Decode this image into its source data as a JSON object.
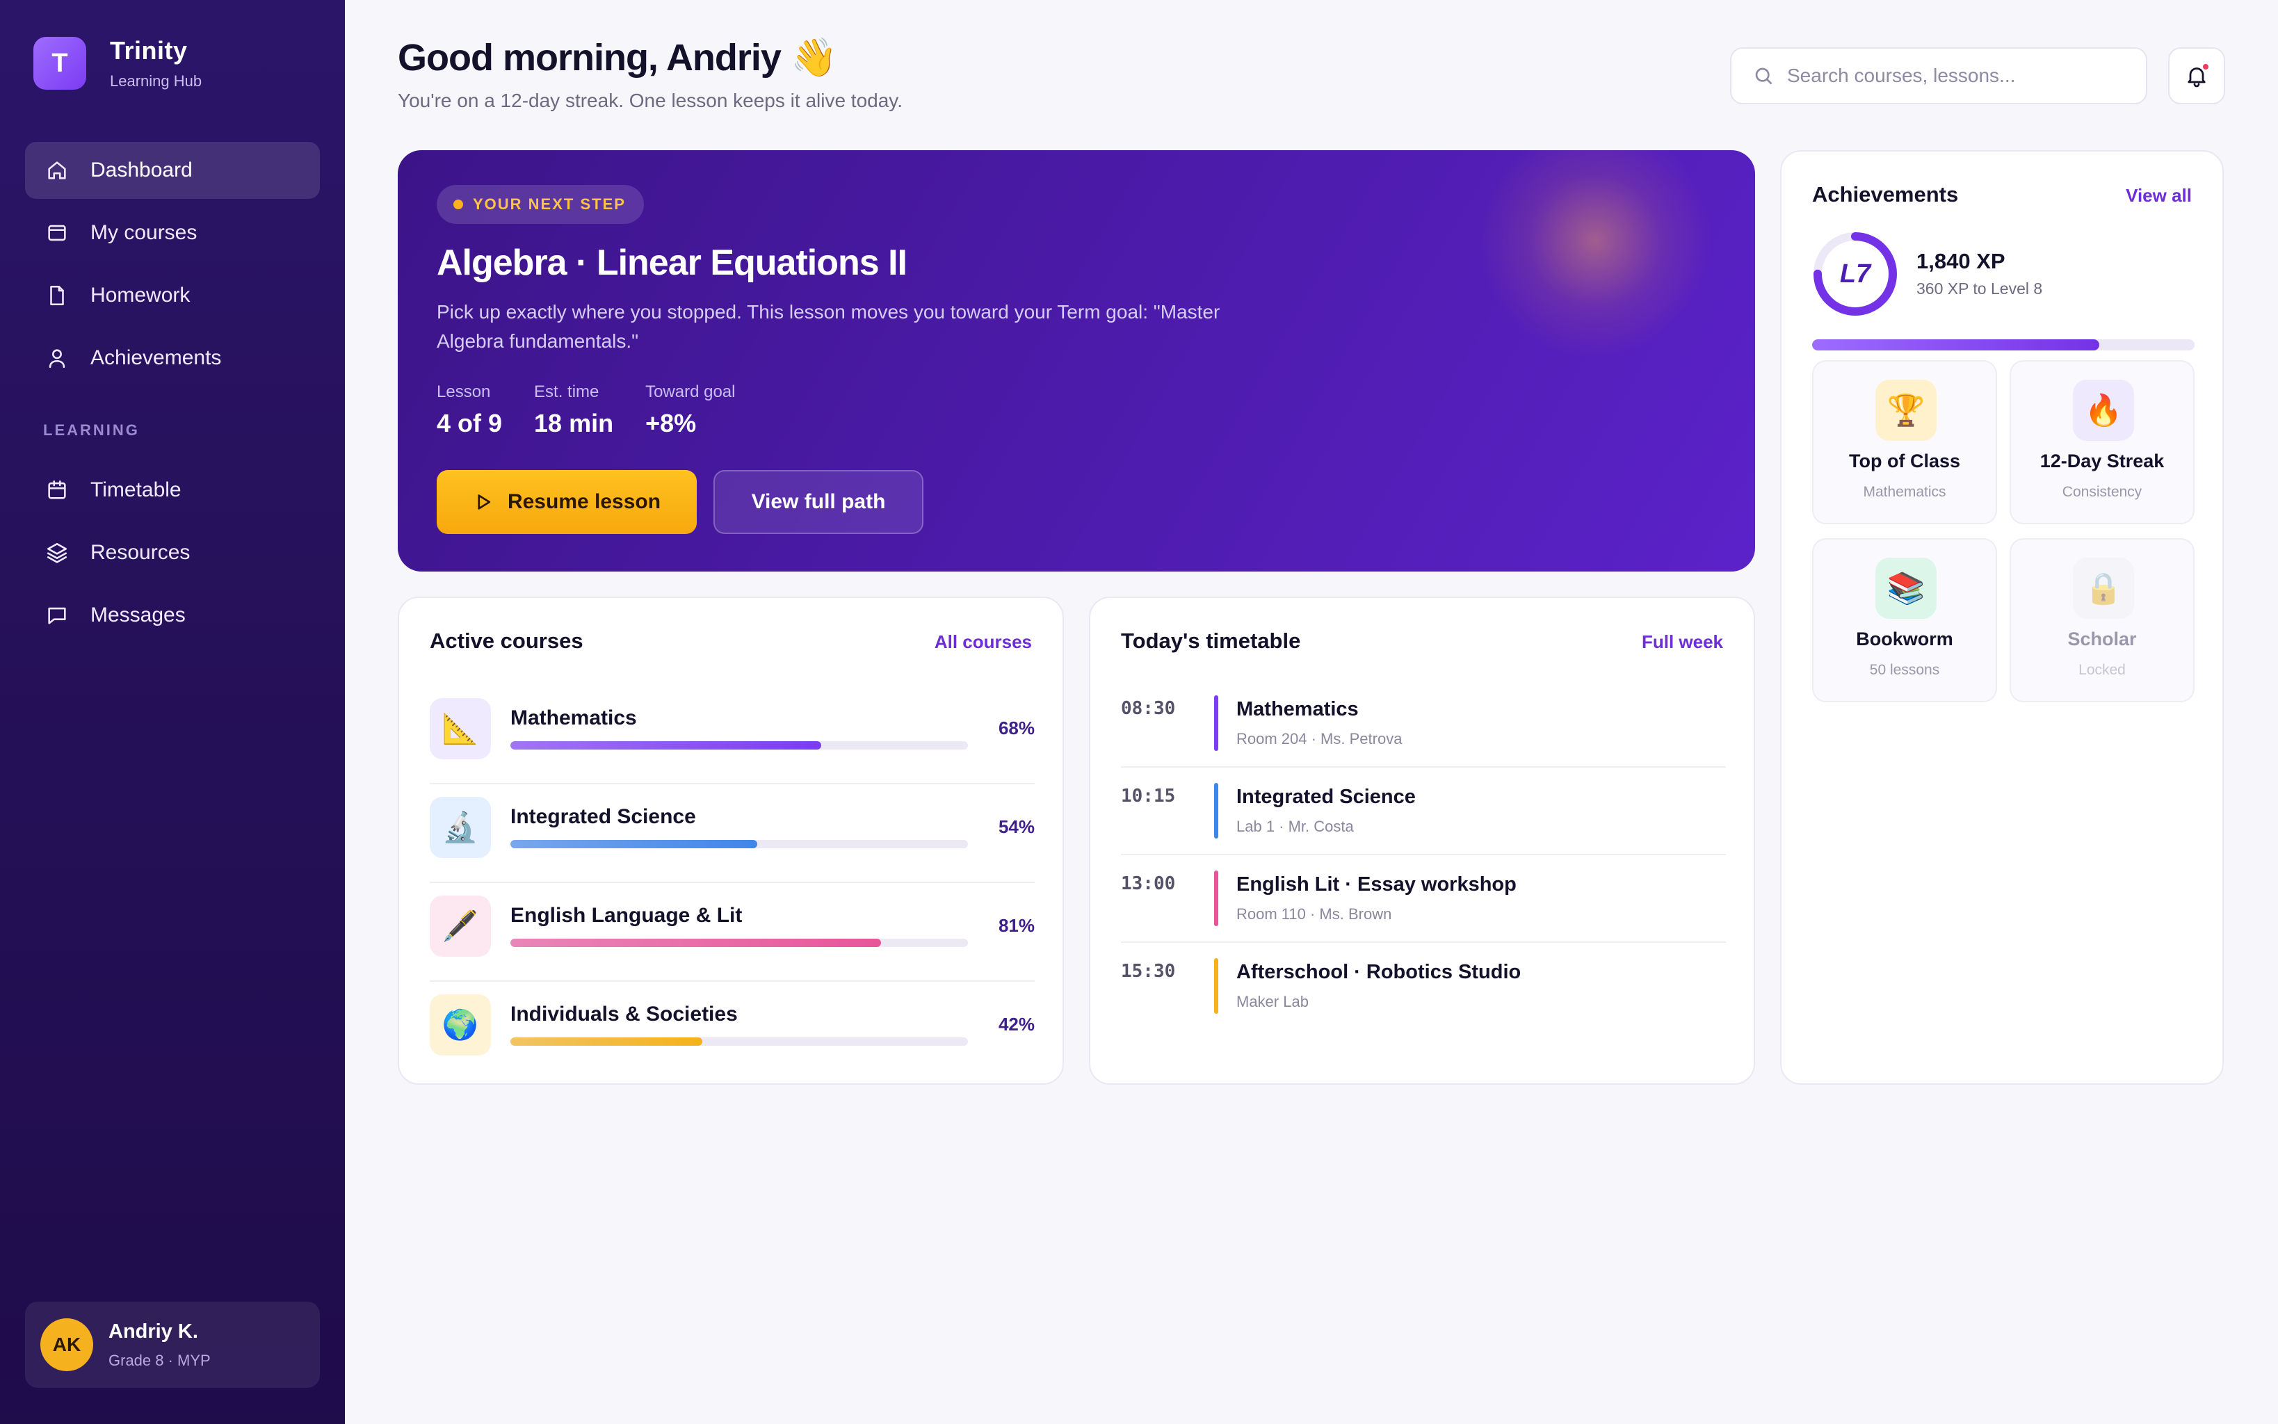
{
  "brand": {
    "logo_letter": "T",
    "name": "Trinity",
    "subtitle": "Learning Hub"
  },
  "nav": {
    "main": [
      {
        "label": "Dashboard",
        "icon": "home-icon",
        "active": true
      },
      {
        "label": "My courses",
        "icon": "courses-icon"
      },
      {
        "label": "Homework",
        "icon": "document-icon"
      },
      {
        "label": "Achievements",
        "icon": "user-icon"
      }
    ],
    "section_label": "LEARNING",
    "learning": [
      {
        "label": "Timetable",
        "icon": "calendar-icon"
      },
      {
        "label": "Resources",
        "icon": "layers-icon"
      },
      {
        "label": "Messages",
        "icon": "chat-icon"
      }
    ]
  },
  "user": {
    "initials": "AK",
    "name": "Andriy K.",
    "meta": "Grade 8 · MYP"
  },
  "header": {
    "greeting": "Good morning, Andriy 👋",
    "subtitle": "You're on a 12-day streak. One lesson keeps it alive today.",
    "search_placeholder": "Search courses, lessons...",
    "notifications_unread": true
  },
  "hero": {
    "pill": "YOUR NEXT STEP",
    "title": "Algebra · Linear Equations II",
    "description": "Pick up exactly where you stopped. This lesson moves you toward your Term goal: \"Master Algebra fundamentals.\"",
    "stats": [
      {
        "label": "Lesson",
        "value": "4 of 9"
      },
      {
        "label": "Est. time",
        "value": "18 min"
      },
      {
        "label": "Toward goal",
        "value": "+8%"
      }
    ],
    "primary_button": "Resume lesson",
    "secondary_button": "View full path"
  },
  "courses": {
    "title": "Active courses",
    "link": "All courses",
    "items": [
      {
        "name": "Mathematics",
        "percent_label": "68%",
        "progress": 0.68,
        "icon": "📐",
        "icon_bg": "#efeafd",
        "color": "#7b3cf2"
      },
      {
        "name": "Integrated Science",
        "percent_label": "54%",
        "progress": 0.54,
        "icon": "🔬",
        "icon_bg": "#e4efff",
        "color": "#3f86ea"
      },
      {
        "name": "English Language & Lit",
        "percent_label": "81%",
        "progress": 0.81,
        "icon": "🖋️",
        "icon_bg": "#fde8f2",
        "color": "#e8559a"
      },
      {
        "name": "Individuals & Societies",
        "percent_label": "42%",
        "progress": 0.42,
        "icon": "🌍",
        "icon_bg": "#fff3d6",
        "color": "#f4b21b"
      }
    ]
  },
  "timetable": {
    "title": "Today's timetable",
    "link": "Full week",
    "items": [
      {
        "time": "08:30",
        "name": "Mathematics",
        "meta": "Room 204 · Ms. Petrova",
        "color": "#7b3cf2"
      },
      {
        "time": "10:15",
        "name": "Integrated Science",
        "meta": "Lab 1 · Mr. Costa",
        "color": "#3f86ea"
      },
      {
        "time": "13:00",
        "name": "English Lit · Essay workshop",
        "meta": "Room 110 · Ms. Brown",
        "color": "#e8559a"
      },
      {
        "time": "15:30",
        "name": "Afterschool · Robotics Studio",
        "meta": "Maker Lab",
        "color": "#f4b21b"
      }
    ]
  },
  "achievements": {
    "title": "Achievements",
    "link": "View all",
    "level": "L7",
    "xp": "1,840 XP",
    "xp_sub": "360 XP to Level 8",
    "progress": 0.75,
    "badges": [
      {
        "name": "Top of Class",
        "sub": "Mathematics",
        "icon": "🏆",
        "icon_bg": "#fff1cc",
        "locked": false
      },
      {
        "name": "12-Day Streak",
        "sub": "Consistency",
        "icon": "🔥",
        "icon_bg": "#efe9fd",
        "locked": false
      },
      {
        "name": "Bookworm",
        "sub": "50 lessons",
        "icon": "📚",
        "icon_bg": "#dcf6ea",
        "locked": false
      },
      {
        "name": "Scholar",
        "sub": "Locked",
        "icon": "🔒",
        "icon_bg": "#f1eff6",
        "locked": true
      }
    ]
  },
  "colors": {
    "accent": "#6d2ed8",
    "sidebar": "#2b1569",
    "primary_button": "#ffc21f"
  }
}
